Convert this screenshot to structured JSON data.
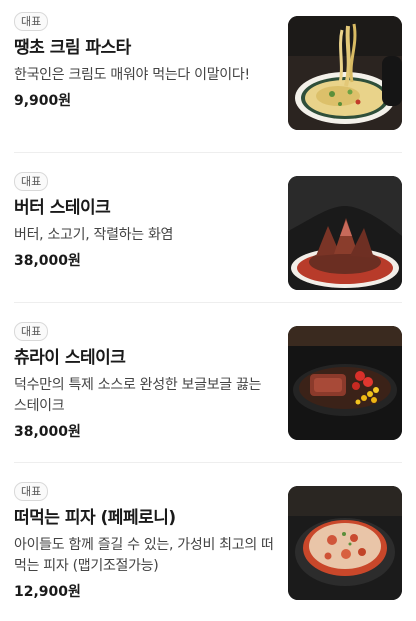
{
  "menu": {
    "items": [
      {
        "badge": "대표",
        "name": "땡초 크림 파스타",
        "description": "한국인은 크림도 매워야 먹는다 이말이다!",
        "price": "9,900원",
        "image_icon": "pasta-photo"
      },
      {
        "badge": "대표",
        "name": "버터 스테이크",
        "description": "버터, 소고기, 작렬하는 화염",
        "price": "38,000원",
        "image_icon": "butter-steak-photo"
      },
      {
        "badge": "대표",
        "name": "츄라이 스테이크",
        "description": "덕수만의 특제 소스로 완성한 보글보글 끓는 스테이크",
        "price": "38,000원",
        "image_icon": "sizzling-steak-photo"
      },
      {
        "badge": "대표",
        "name": "떠먹는 피자 (페페로니)",
        "description": "아이들도 함께 즐길 수 있는, 가성비 최고의 떠먹는 피자 (맵기조절가능)",
        "price": "12,900원",
        "image_icon": "spoon-pizza-photo"
      }
    ]
  },
  "colors": {
    "text": "#1a1a1a",
    "subtext": "#444444",
    "badge_border": "#d9d9d9",
    "divider": "#eeeeee"
  }
}
